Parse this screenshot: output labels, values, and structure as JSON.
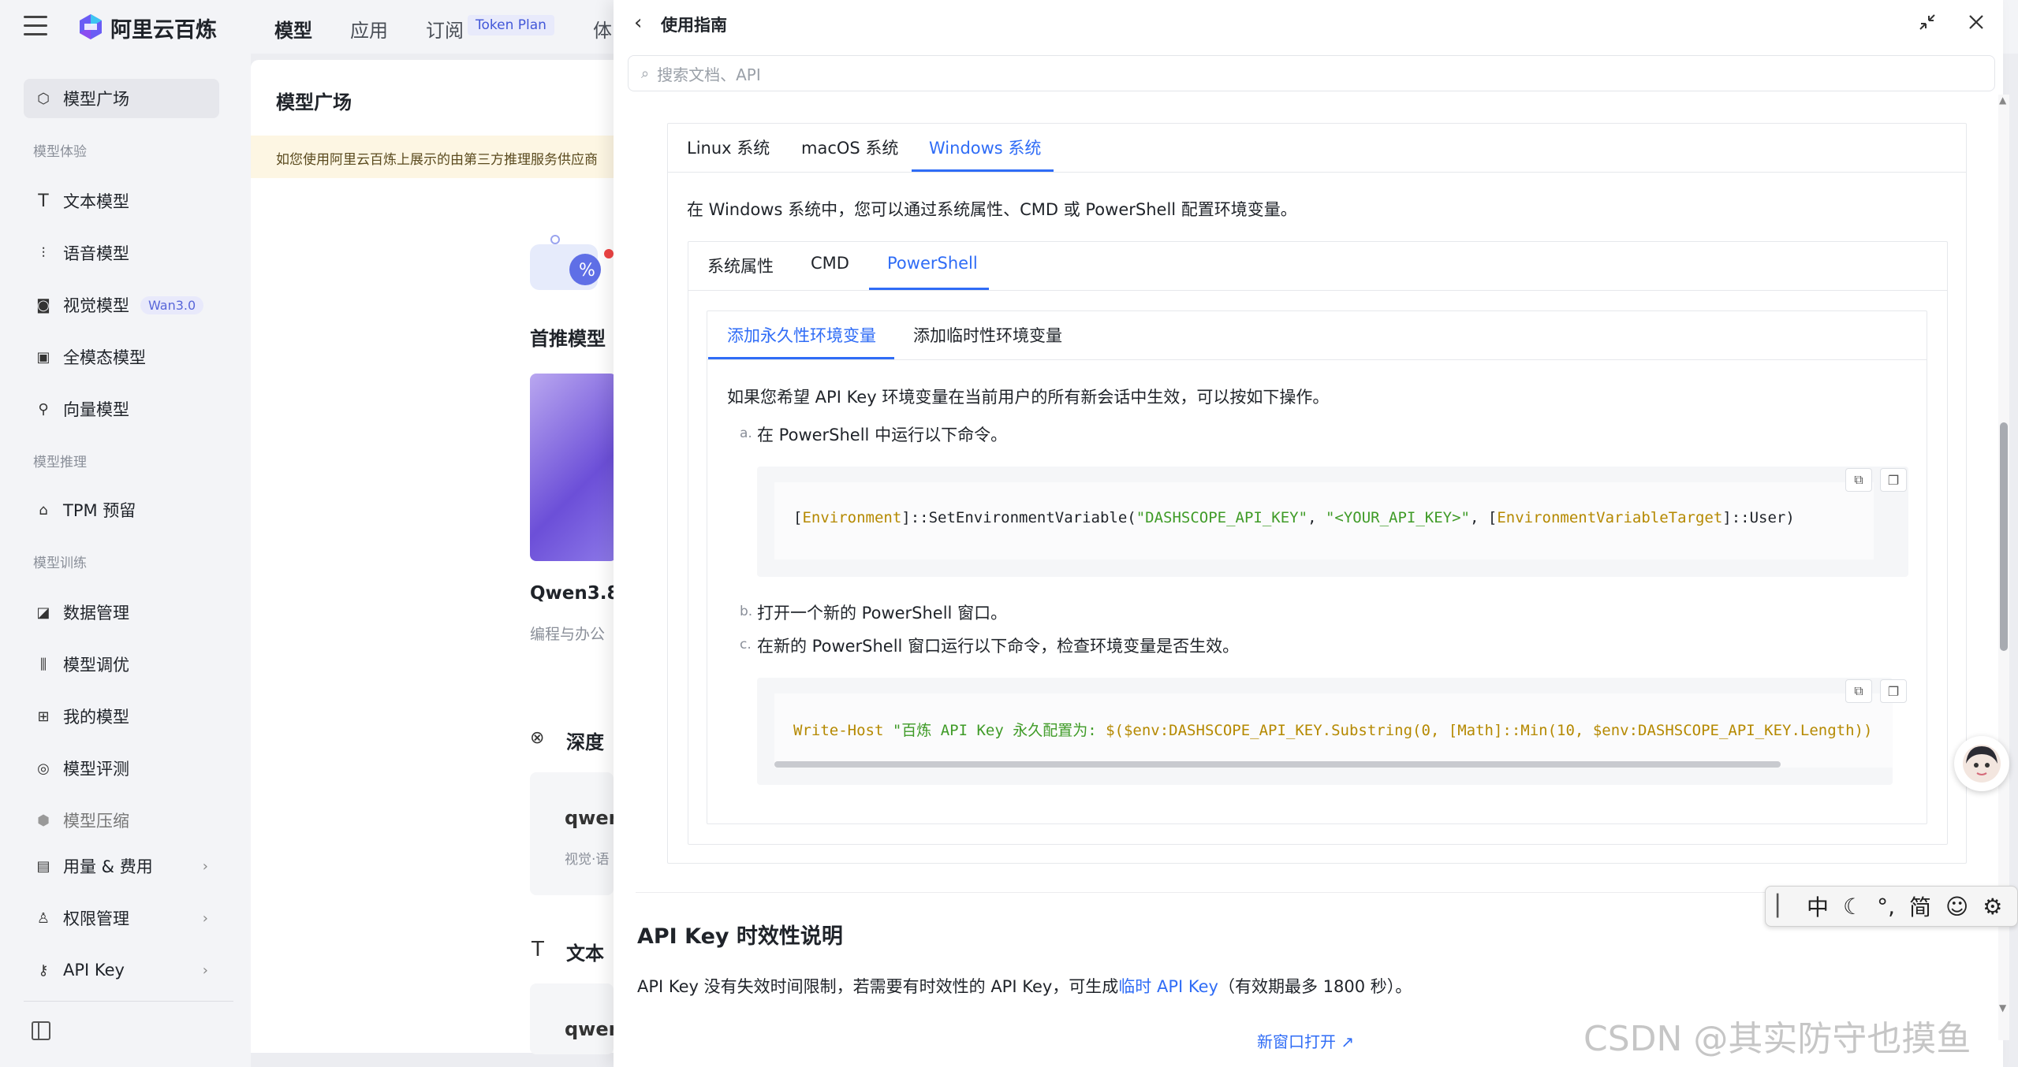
{
  "app": {
    "name": "阿里云百炼"
  },
  "topnav": {
    "items": [
      "模型",
      "应用",
      "订阅",
      "体"
    ],
    "token_badge": "Token Plan"
  },
  "sidebar": {
    "active": "模型广场",
    "sections": {
      "exp": "模型体验",
      "infer": "模型推理",
      "train": "模型训练"
    },
    "items": {
      "plaza": "模型广场",
      "text": "文本模型",
      "voice": "语音模型",
      "vision": "视觉模型",
      "vision_badge": "Wan3.0",
      "omni": "全模态模型",
      "vector": "向量模型",
      "tpm": "TPM 预留",
      "data": "数据管理",
      "tune": "模型调优",
      "mine": "我的模型",
      "eval": "模型评测",
      "compress": "模型压缩",
      "usage": "用量 & 费用",
      "perm": "权限管理",
      "apikey": "API Key"
    }
  },
  "main": {
    "title": "模型广场",
    "notice": "如您使用阿里云百炼上展示的由第三方推理服务供应商",
    "recommend": "首推模型",
    "card_title": "Qwen3.8",
    "card_sub": "编程与办公",
    "deep": "深度",
    "qwen1": "qwen",
    "qwen1_sub": "视觉·语",
    "text_section": "文本",
    "qwen2": "qwen"
  },
  "panel": {
    "title": "使用指南",
    "search_placeholder": "搜索文档、API",
    "os_tabs": [
      "Linux 系统",
      "macOS 系统",
      "Windows 系统"
    ],
    "os_active": 2,
    "windows_intro": "在 Windows 系统中，您可以通过系统属性、CMD 或 PowerShell 配置环境变量。",
    "method_tabs": [
      "系统属性",
      "CMD",
      "PowerShell"
    ],
    "method_active": 2,
    "scope_tabs": [
      "添加永久性环境变量",
      "添加临时性环境变量"
    ],
    "scope_active": 0,
    "perm_intro": "如果您希望 API Key 环境变量在当前用户的所有新会话中生效，可以按如下操作。",
    "step_a_label": "a.",
    "step_a": "在 PowerShell 中运行以下命令。",
    "code1": {
      "p1": "[",
      "p2": "Environment",
      "p3": "]::SetEnvironmentVariable(",
      "p4": "\"DASHSCOPE_API_KEY\"",
      "p5": ", ",
      "p6": "\"<YOUR_API_KEY>\"",
      "p7": ", [",
      "p8": "EnvironmentVariableTarget",
      "p9": "]::User)"
    },
    "step_b_label": "b.",
    "step_b": "打开一个新的 PowerShell 窗口。",
    "step_c_label": "c.",
    "step_c": "在新的 PowerShell 窗口运行以下命令，检查环境变量是否生效。",
    "code2": {
      "p1": "Write-Host",
      "p2": " \"百炼 API Key 永久配置为: ",
      "p3": "$($env:DASHSCOPE_API_KEY.Substring(0, [Math]::Min(10, $env:DASHSCOPE_API_KEY.Length))"
    },
    "apikey_heading": "API Key 时效性说明",
    "apikey_text_pre": "API Key 没有失效时间限制，若需要有时效性的 API Key，可生成",
    "apikey_link": "临时 API Key",
    "apikey_text_post": "（有效期最多 1800 秒）。",
    "new_window": "新窗口打开 ↗"
  },
  "ime": {
    "items": [
      "中",
      "简"
    ]
  },
  "watermark": "CSDN @其实防守也摸鱼"
}
